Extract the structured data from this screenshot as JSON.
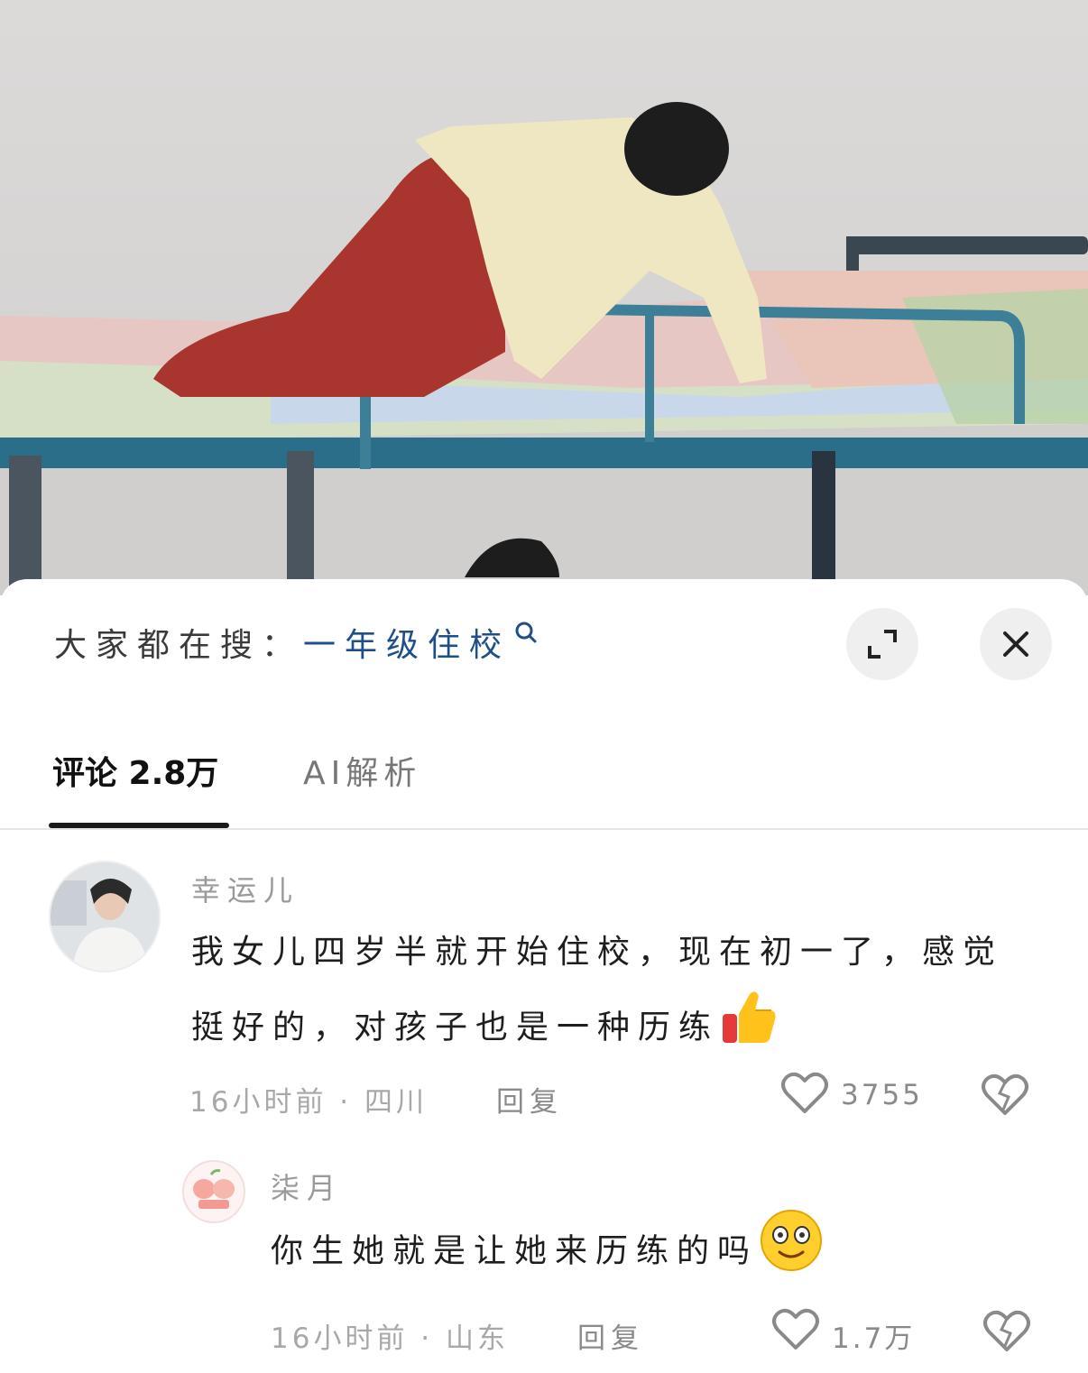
{
  "search": {
    "prefix": "大家都在搜：",
    "term": "一年级住校"
  },
  "tabs": [
    {
      "label": "评论 2.8万",
      "active": true
    },
    {
      "label": "AI解析",
      "active": false
    }
  ],
  "comments": [
    {
      "user": "幸运儿",
      "text_line1": "我女儿四岁半就开始住校，现在初一了，感觉",
      "text_line2": "挺好的，对孩子也是一种历练",
      "emoji": "thumbs-up",
      "meta": "16小时前 · 四川",
      "reply_label": "回复",
      "likes": "3755"
    },
    {
      "user": "柒月",
      "text_line1": "你生她就是让她来历练的吗",
      "emoji": "grinning-face",
      "meta": "16小时前 · 山东",
      "reply_label": "回复",
      "likes": "1.7万"
    }
  ],
  "colors": {
    "search_term": "#1f4f8a",
    "muted_text": "#a8a8a8",
    "body_text": "#1e1e1e"
  }
}
